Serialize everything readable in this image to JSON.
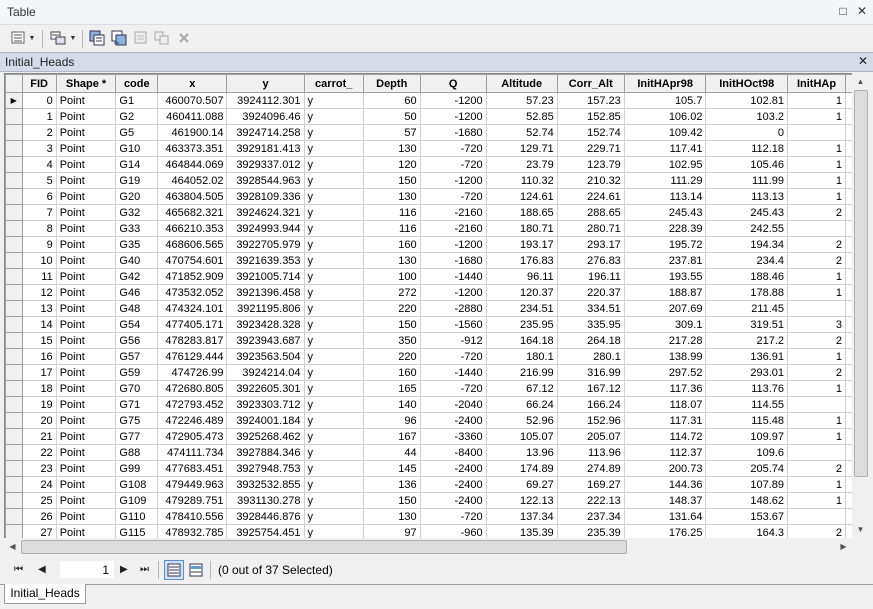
{
  "window": {
    "title": "Table",
    "restore_icon": "□",
    "close_icon": "✕"
  },
  "toolbar": {
    "items": [
      "table-options-icon",
      "related-tables-icon",
      "select-by-attributes-icon",
      "switch-selection-icon",
      "clear-selection-icon",
      "zoom-to-selected-icon",
      "delete-selected-icon"
    ]
  },
  "tab": {
    "name": "Initial_Heads",
    "close_icon": "✕"
  },
  "table": {
    "columns": [
      "FID",
      "Shape *",
      "code",
      "x",
      "y",
      "carrot_",
      "Depth",
      "Q",
      "Altitude",
      "Corr_Alt",
      "InitHApr98",
      "InitHOct98",
      "InitHAp"
    ],
    "rows": [
      [
        "0",
        "Point",
        "G1",
        "460070.507",
        "3924112.301",
        "y",
        "60",
        "-1200",
        "57.23",
        "157.23",
        "105.7",
        "102.81",
        "1"
      ],
      [
        "1",
        "Point",
        "G2",
        "460411.088",
        "3924096.46",
        "y",
        "50",
        "-1200",
        "52.85",
        "152.85",
        "106.02",
        "103.2",
        "1"
      ],
      [
        "2",
        "Point",
        "G5",
        "461900.14",
        "3924714.258",
        "y",
        "57",
        "-1680",
        "52.74",
        "152.74",
        "109.42",
        "0",
        ""
      ],
      [
        "3",
        "Point",
        "G10",
        "463373.351",
        "3929181.413",
        "y",
        "130",
        "-720",
        "129.71",
        "229.71",
        "117.41",
        "112.18",
        "1"
      ],
      [
        "4",
        "Point",
        "G14",
        "464844.069",
        "3929337.012",
        "y",
        "120",
        "-720",
        "23.79",
        "123.79",
        "102.95",
        "105.46",
        "1"
      ],
      [
        "5",
        "Point",
        "G19",
        "464052.02",
        "3928544.963",
        "y",
        "150",
        "-1200",
        "110.32",
        "210.32",
        "111.29",
        "111.99",
        "1"
      ],
      [
        "6",
        "Point",
        "G20",
        "463804.505",
        "3928109.336",
        "y",
        "130",
        "-720",
        "124.61",
        "224.61",
        "113.14",
        "113.13",
        "1"
      ],
      [
        "7",
        "Point",
        "G32",
        "465682.321",
        "3924624.321",
        "y",
        "116",
        "-2160",
        "188.65",
        "288.65",
        "245.43",
        "245.43",
        "2"
      ],
      [
        "8",
        "Point",
        "G33",
        "466210.353",
        "3924993.944",
        "y",
        "116",
        "-2160",
        "180.71",
        "280.71",
        "228.39",
        "242.55",
        ""
      ],
      [
        "9",
        "Point",
        "G35",
        "468606.565",
        "3922705.979",
        "y",
        "160",
        "-1200",
        "193.17",
        "293.17",
        "195.72",
        "194.34",
        "2"
      ],
      [
        "10",
        "Point",
        "G40",
        "470754.601",
        "3921639.353",
        "y",
        "130",
        "-1680",
        "176.83",
        "276.83",
        "237.81",
        "234.4",
        "2"
      ],
      [
        "11",
        "Point",
        "G42",
        "471852.909",
        "3921005.714",
        "y",
        "100",
        "-1440",
        "96.11",
        "196.11",
        "193.55",
        "188.46",
        "1"
      ],
      [
        "12",
        "Point",
        "G46",
        "473532.052",
        "3921396.458",
        "y",
        "272",
        "-1200",
        "120.37",
        "220.37",
        "188.87",
        "178.88",
        "1"
      ],
      [
        "13",
        "Point",
        "G48",
        "474324.101",
        "3921195.806",
        "y",
        "220",
        "-2880",
        "234.51",
        "334.51",
        "207.69",
        "211.45",
        ""
      ],
      [
        "14",
        "Point",
        "G54",
        "477405.171",
        "3923428.328",
        "y",
        "150",
        "-1560",
        "235.95",
        "335.95",
        "309.1",
        "319.51",
        "3"
      ],
      [
        "15",
        "Point",
        "G56",
        "478283.817",
        "3923943.687",
        "y",
        "350",
        "-912",
        "164.18",
        "264.18",
        "217.28",
        "217.2",
        "2"
      ],
      [
        "16",
        "Point",
        "G57",
        "476129.444",
        "3923563.504",
        "y",
        "220",
        "-720",
        "180.1",
        "280.1",
        "138.99",
        "136.91",
        "1"
      ],
      [
        "17",
        "Point",
        "G59",
        "474726.99",
        "3924214.04",
        "y",
        "160",
        "-1440",
        "216.99",
        "316.99",
        "297.52",
        "293.01",
        "2"
      ],
      [
        "18",
        "Point",
        "G70",
        "472680.805",
        "3922605.301",
        "y",
        "165",
        "-720",
        "67.12",
        "167.12",
        "117.36",
        "113.76",
        "1"
      ],
      [
        "19",
        "Point",
        "G71",
        "472793.452",
        "3923303.712",
        "y",
        "140",
        "-2040",
        "66.24",
        "166.24",
        "118.07",
        "114.55",
        ""
      ],
      [
        "20",
        "Point",
        "G75",
        "472246.489",
        "3924001.184",
        "y",
        "96",
        "-2400",
        "52.96",
        "152.96",
        "117.31",
        "115.48",
        "1"
      ],
      [
        "21",
        "Point",
        "G77",
        "472905.473",
        "3925268.462",
        "y",
        "167",
        "-3360",
        "105.07",
        "205.07",
        "114.72",
        "109.97",
        "1"
      ],
      [
        "22",
        "Point",
        "G88",
        "474111.734",
        "3927884.346",
        "y",
        "44",
        "-8400",
        "13.96",
        "113.96",
        "112.37",
        "109.6",
        ""
      ],
      [
        "23",
        "Point",
        "G99",
        "477683.451",
        "3927948.753",
        "y",
        "145",
        "-2400",
        "174.89",
        "274.89",
        "200.73",
        "205.74",
        "2"
      ],
      [
        "24",
        "Point",
        "G108",
        "479449.963",
        "3932532.855",
        "y",
        "136",
        "-2400",
        "69.27",
        "169.27",
        "144.36",
        "107.89",
        "1"
      ],
      [
        "25",
        "Point",
        "G109",
        "479289.751",
        "3931130.278",
        "y",
        "150",
        "-2400",
        "122.13",
        "222.13",
        "148.37",
        "148.62",
        "1"
      ],
      [
        "26",
        "Point",
        "G110",
        "478410.556",
        "3928446.876",
        "y",
        "130",
        "-720",
        "137.34",
        "237.34",
        "131.64",
        "153.67",
        ""
      ],
      [
        "27",
        "Point",
        "G115",
        "478932.785",
        "3925754.451",
        "y",
        "97",
        "-960",
        "135.39",
        "235.39",
        "176.25",
        "164.3",
        "2"
      ]
    ],
    "current_row_marker": "▶"
  },
  "status": {
    "first_icon": "⏮",
    "prev_icon": "◀",
    "record": "1",
    "next_icon": "▶",
    "last_icon": "⏭",
    "selection_text": "(0 out of 37 Selected)"
  },
  "bottom_tab": "Initial_Heads",
  "colors": {
    "header_bg": "#f0f0f0",
    "tab_bg": "#d6dbe9",
    "accent": "#5b8fd1"
  }
}
